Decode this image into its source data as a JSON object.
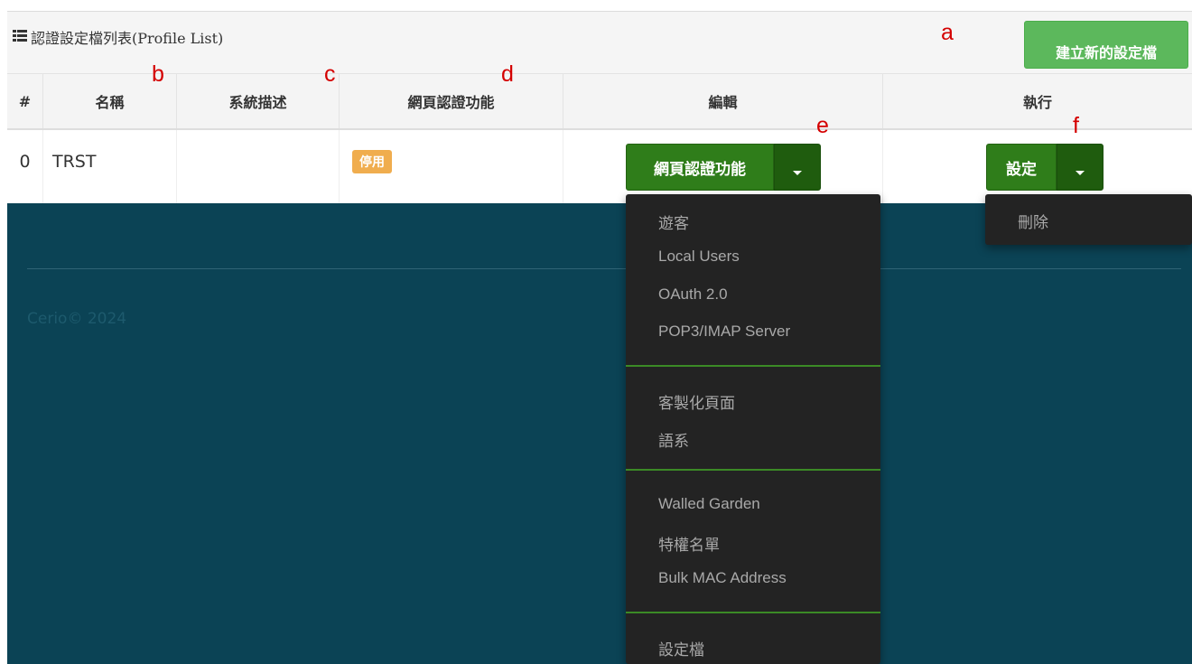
{
  "panel": {
    "title": "認證設定檔列表(Profile List)",
    "create_button": "建立新的設定檔"
  },
  "table": {
    "headers": [
      "#",
      "名稱",
      "系統描述",
      "網頁認證功能",
      "編輯",
      "執行"
    ],
    "rows": [
      {
        "index": "0",
        "name": "TRST",
        "description": "",
        "web_auth_status": "停用",
        "edit_button": "網頁認證功能",
        "exec_button": "設定"
      }
    ]
  },
  "edit_menu": {
    "items": [
      "遊客",
      "Local Users",
      "OAuth 2.0",
      "POP3/IMAP Server",
      "客製化頁面",
      "語系",
      "Walled Garden",
      "特權名單",
      "Bulk MAC Address",
      "設定檔"
    ]
  },
  "exec_menu": {
    "items": [
      "刪除"
    ]
  },
  "footer": {
    "copyright": "Cerio© 2024"
  },
  "annotations": [
    "a",
    "b",
    "c",
    "d",
    "e",
    "f"
  ],
  "colors": {
    "success_light": "#5cb85c",
    "success_dark": "#2f7d1a",
    "warning": "#f0ad4e",
    "footer_bg": "#0b4355",
    "menu_bg": "#232323",
    "annotation": "#d40000"
  }
}
